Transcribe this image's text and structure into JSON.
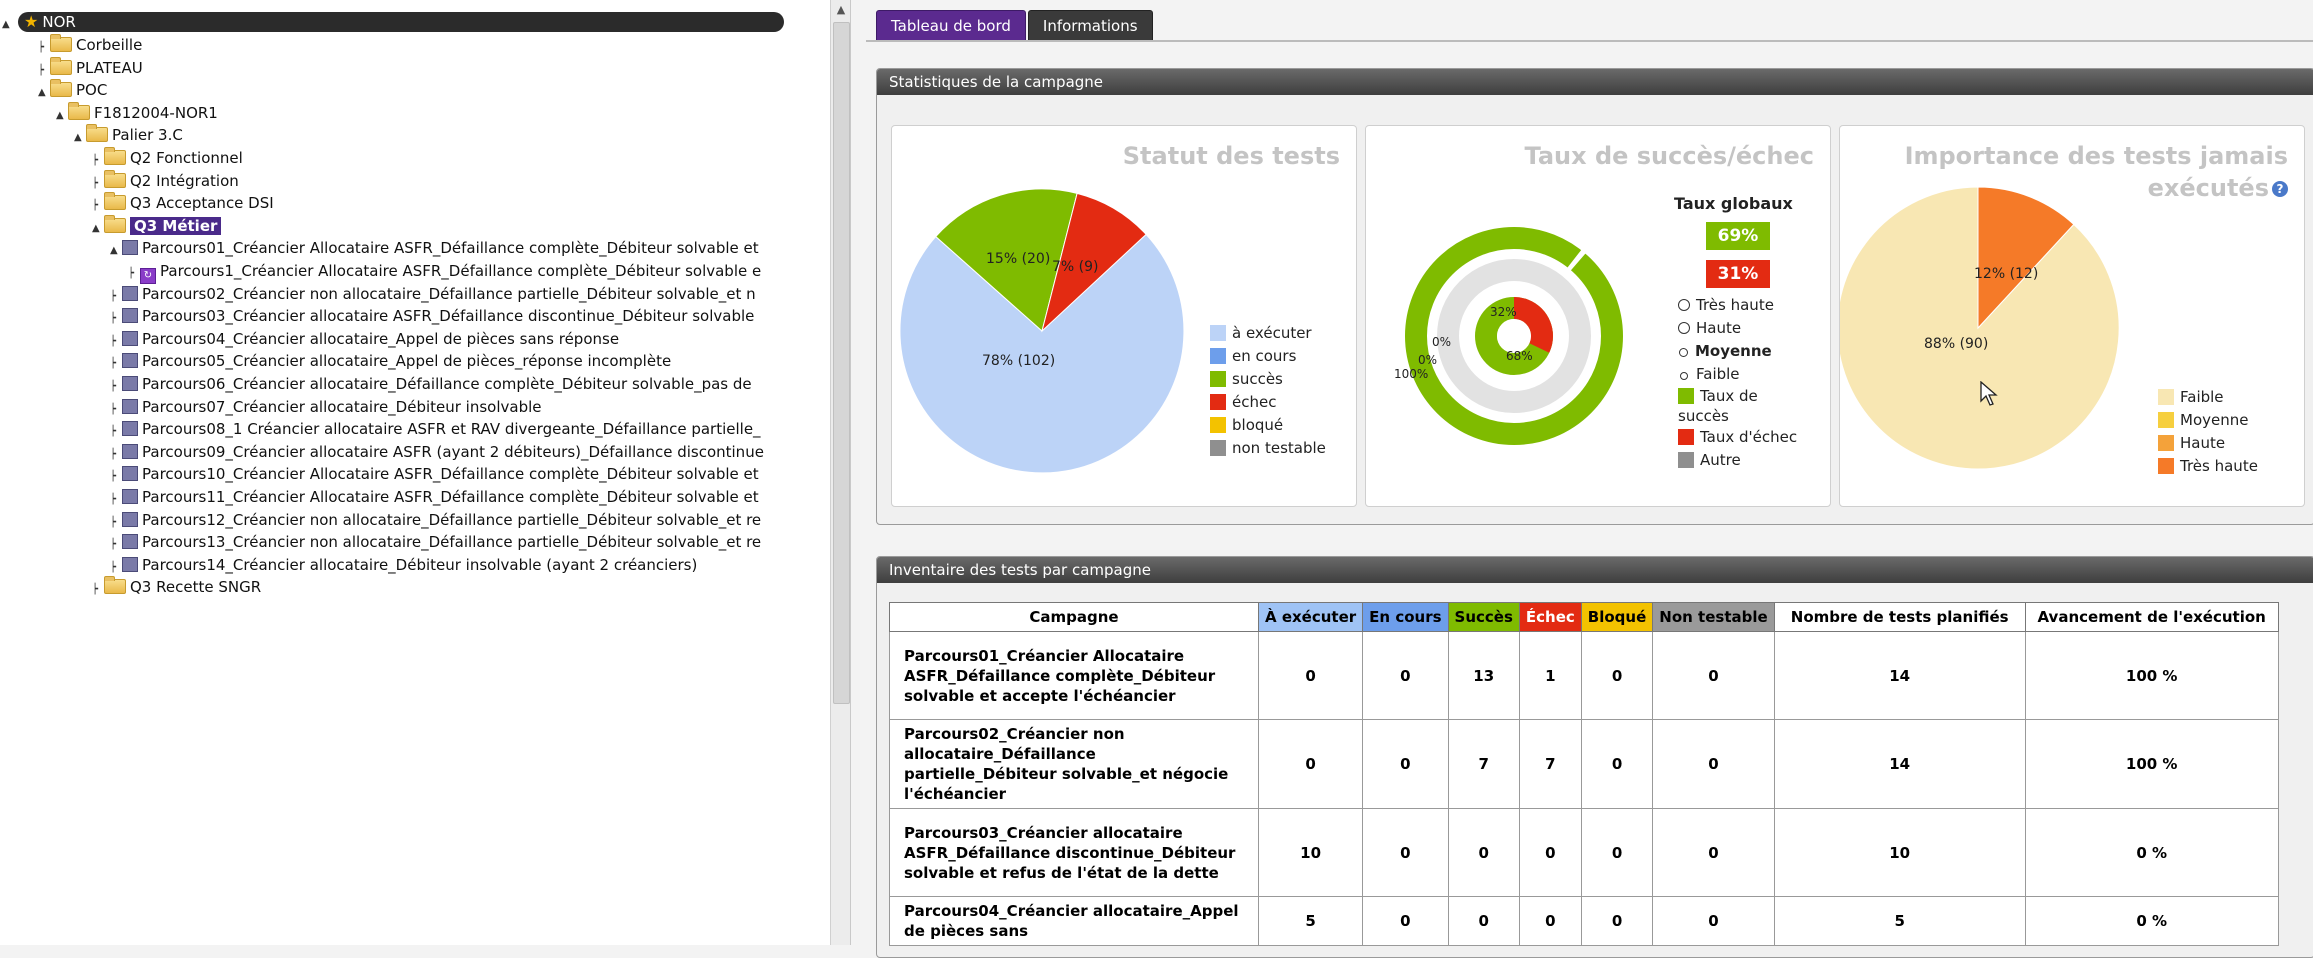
{
  "tree": {
    "root": "NOR",
    "nodes": [
      {
        "label": "Corbeille",
        "type": "folder",
        "depth": 1
      },
      {
        "label": "PLATEAU",
        "type": "folder",
        "depth": 1
      },
      {
        "label": "POC",
        "type": "folder",
        "depth": 1
      },
      {
        "label": "F1812004-NOR1",
        "type": "folder",
        "depth": 2
      },
      {
        "label": "Palier 3.C",
        "type": "folder",
        "depth": 3
      },
      {
        "label": "Q2 Fonctionnel",
        "type": "folder",
        "depth": 4
      },
      {
        "label": "Q2 Intégration",
        "type": "folder",
        "depth": 4
      },
      {
        "label": "Q3 Acceptance DSI",
        "type": "folder",
        "depth": 4
      },
      {
        "label": "Q3 Métier",
        "type": "folder",
        "depth": 4,
        "selected": true
      },
      {
        "label": "Parcours01_Créancier Allocataire ASFR_Défaillance complète_Débiteur solvable et",
        "type": "campaign",
        "depth": 5
      },
      {
        "label": "Parcours1_Créancier Allocataire ASFR_Défaillance complète_Débiteur solvable e",
        "type": "iteration",
        "depth": 6
      },
      {
        "label": "Parcours02_Créancier non allocataire_Défaillance partielle_Débiteur solvable_et n",
        "type": "campaign",
        "depth": 5
      },
      {
        "label": "Parcours03_Créancier allocataire ASFR_Défaillance discontinue_Débiteur solvable",
        "type": "campaign",
        "depth": 5
      },
      {
        "label": "Parcours04_Créancier allocataire_Appel de pièces sans réponse",
        "type": "campaign",
        "depth": 5
      },
      {
        "label": "Parcours05_Créancier allocataire_Appel de pièces_réponse incomplète",
        "type": "campaign",
        "depth": 5
      },
      {
        "label": "Parcours06_Créancier allocataire_Défaillance complète_Débiteur solvable_pas de",
        "type": "campaign",
        "depth": 5
      },
      {
        "label": "Parcours07_Créancier allocataire_Débiteur insolvable",
        "type": "campaign",
        "depth": 5
      },
      {
        "label": "Parcours08_1 Créancier allocataire ASFR et RAV divergeante_Défaillance partielle_",
        "type": "campaign",
        "depth": 5
      },
      {
        "label": "Parcours09_Créancier allocataire ASFR (ayant 2 débiteurs)_Défaillance discontinue",
        "type": "campaign",
        "depth": 5
      },
      {
        "label": "Parcours10_Créancier Allocataire ASFR_Défaillance complète_Débiteur solvable et",
        "type": "campaign",
        "depth": 5
      },
      {
        "label": "Parcours11_Créancier Allocataire ASFR_Défaillance complète_Débiteur solvable et",
        "type": "campaign",
        "depth": 5
      },
      {
        "label": "Parcours12_Créancier non allocataire_Défaillance partielle_Débiteur solvable_et re",
        "type": "campaign",
        "depth": 5
      },
      {
        "label": "Parcours13_Créancier non allocataire_Défaillance partielle_Débiteur solvable_et re",
        "type": "campaign",
        "depth": 5
      },
      {
        "label": "Parcours14_Créancier allocataire_Débiteur insolvable (ayant 2 créanciers)",
        "type": "campaign",
        "depth": 5
      },
      {
        "label": "Q3 Recette SNGR",
        "type": "folder",
        "depth": 4
      }
    ]
  },
  "tabs": {
    "dashboard": "Tableau de bord",
    "info": "Informations"
  },
  "stats": {
    "header": "Statistiques de la campagne",
    "status": {
      "title": "Statut des tests",
      "slice_labels": {
        "todo": "78% (102)",
        "success": "15% (20)",
        "fail": "7% (9)"
      },
      "legend": [
        "à exécuter",
        "en cours",
        "succès",
        "échec",
        "bloqué",
        "non testable"
      ],
      "colors": {
        "todo": "#bcd3f7",
        "running": "#6d9eeb",
        "success": "#7fbb00",
        "fail": "#e32b12",
        "blocked": "#f3c200",
        "untestable": "#8f8f8f"
      }
    },
    "success_rate": {
      "title": "Taux de succès/échec",
      "global_label": "Taux globaux",
      "global_success": "69%",
      "global_fail": "31%",
      "ring_labels": {
        "inner_fail": "32%",
        "inner_success": "68%",
        "mid_zero_a": "0%",
        "mid_zero_b": "0%",
        "outer": "100%"
      },
      "legend_radio": [
        "Très haute",
        "Haute",
        "Moyenne",
        "Faible"
      ],
      "legend_sw": [
        "Taux de succès",
        "Taux d'échec",
        "Autre"
      ]
    },
    "never_run": {
      "title_line1": "Importance des tests jamais",
      "title_line2": "exécutés",
      "help_icon": "?",
      "slice_labels": {
        "low": "88% (90)",
        "high": "12% (12)"
      },
      "legend": [
        "Faible",
        "Moyenne",
        "Haute",
        "Très haute"
      ],
      "colors": {
        "low": "#f8e7b3",
        "medium": "#f6cf3f",
        "high": "#f4a23a",
        "very_high": "#f57a28"
      }
    }
  },
  "inventory": {
    "header": "Inventaire des tests par campagne",
    "columns": [
      "Campagne",
      "À exécuter",
      "En cours",
      "Succès",
      "Échec",
      "Bloqué",
      "Non testable",
      "Nombre de tests planifiés",
      "Avancement de l'exécution"
    ],
    "rows": [
      {
        "campaign": "Parcours01_Créancier Allocataire ASFR_Défaillance complète_Débiteur solvable et accepte l'échéancier",
        "todo": "0",
        "running": "0",
        "success": "13",
        "fail": "1",
        "blocked": "0",
        "untestable": "0",
        "planned": "14",
        "progress": "100 %"
      },
      {
        "campaign": "Parcours02_Créancier non allocataire_Défaillance partielle_Débiteur solvable_et négocie l'échéancier",
        "todo": "0",
        "running": "0",
        "success": "7",
        "fail": "7",
        "blocked": "0",
        "untestable": "0",
        "planned": "14",
        "progress": "100 %"
      },
      {
        "campaign": "Parcours03_Créancier allocataire ASFR_Défaillance discontinue_Débiteur solvable et refus de l'état de la dette",
        "todo": "10",
        "running": "0",
        "success": "0",
        "fail": "0",
        "blocked": "0",
        "untestable": "0",
        "planned": "10",
        "progress": "0 %"
      },
      {
        "campaign": "Parcours04_Créancier allocataire_Appel de pièces sans",
        "todo": "5",
        "running": "0",
        "success": "0",
        "fail": "0",
        "blocked": "0",
        "untestable": "0",
        "planned": "5",
        "progress": "0 %"
      }
    ]
  }
}
